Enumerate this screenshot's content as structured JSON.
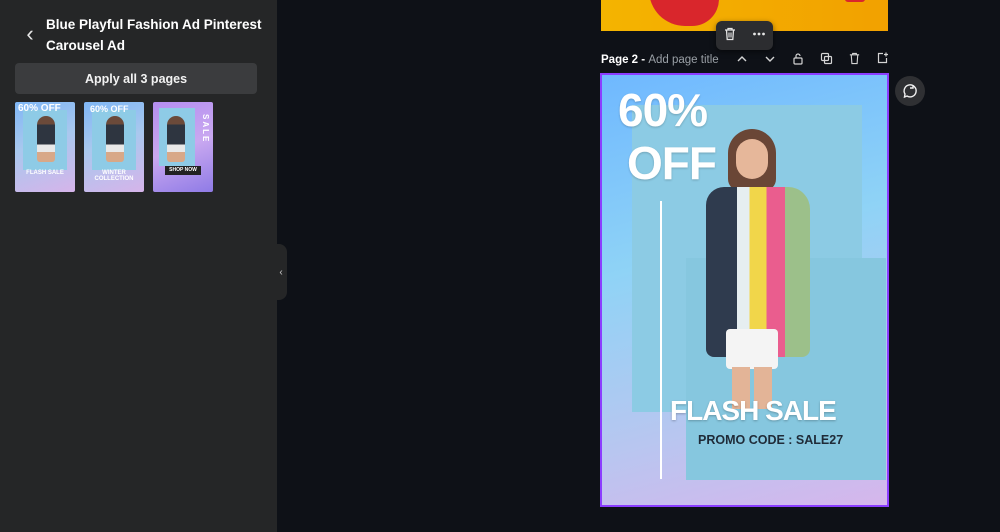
{
  "panel": {
    "title": "Blue Playful Fashion Ad Pinterest Carousel Ad",
    "apply_button": "Apply all 3 pages",
    "thumbnails": [
      {
        "headline": "60% OFF",
        "caption": "FLASH SALE"
      },
      {
        "headline": "60% OFF",
        "caption": "WINTER COLLECTION"
      },
      {
        "badge": "SHOP NOW",
        "vertical_text": "SALE"
      }
    ]
  },
  "page": {
    "label": "Page 2",
    "separator": " - ",
    "title_placeholder": "Add page title"
  },
  "design": {
    "headline_line1": "60%",
    "headline_line2": "OFF",
    "banner": "FLASH SALE",
    "promo": "PROMO CODE : SALE27"
  },
  "icons": {
    "back": "chevron-left-icon",
    "collapse": "chevron-left-icon",
    "toolbar": [
      "trash-icon",
      "more-icon"
    ],
    "page_tools": [
      "chevron-up-icon",
      "chevron-down-icon",
      "lock-icon",
      "duplicate-icon",
      "trash-icon",
      "add-page-icon"
    ],
    "side": "refresh-comment-icon"
  },
  "colors": {
    "selection": "#8b3dff",
    "panel_bg": "#252627",
    "canvas_bg": "#0e1117"
  }
}
